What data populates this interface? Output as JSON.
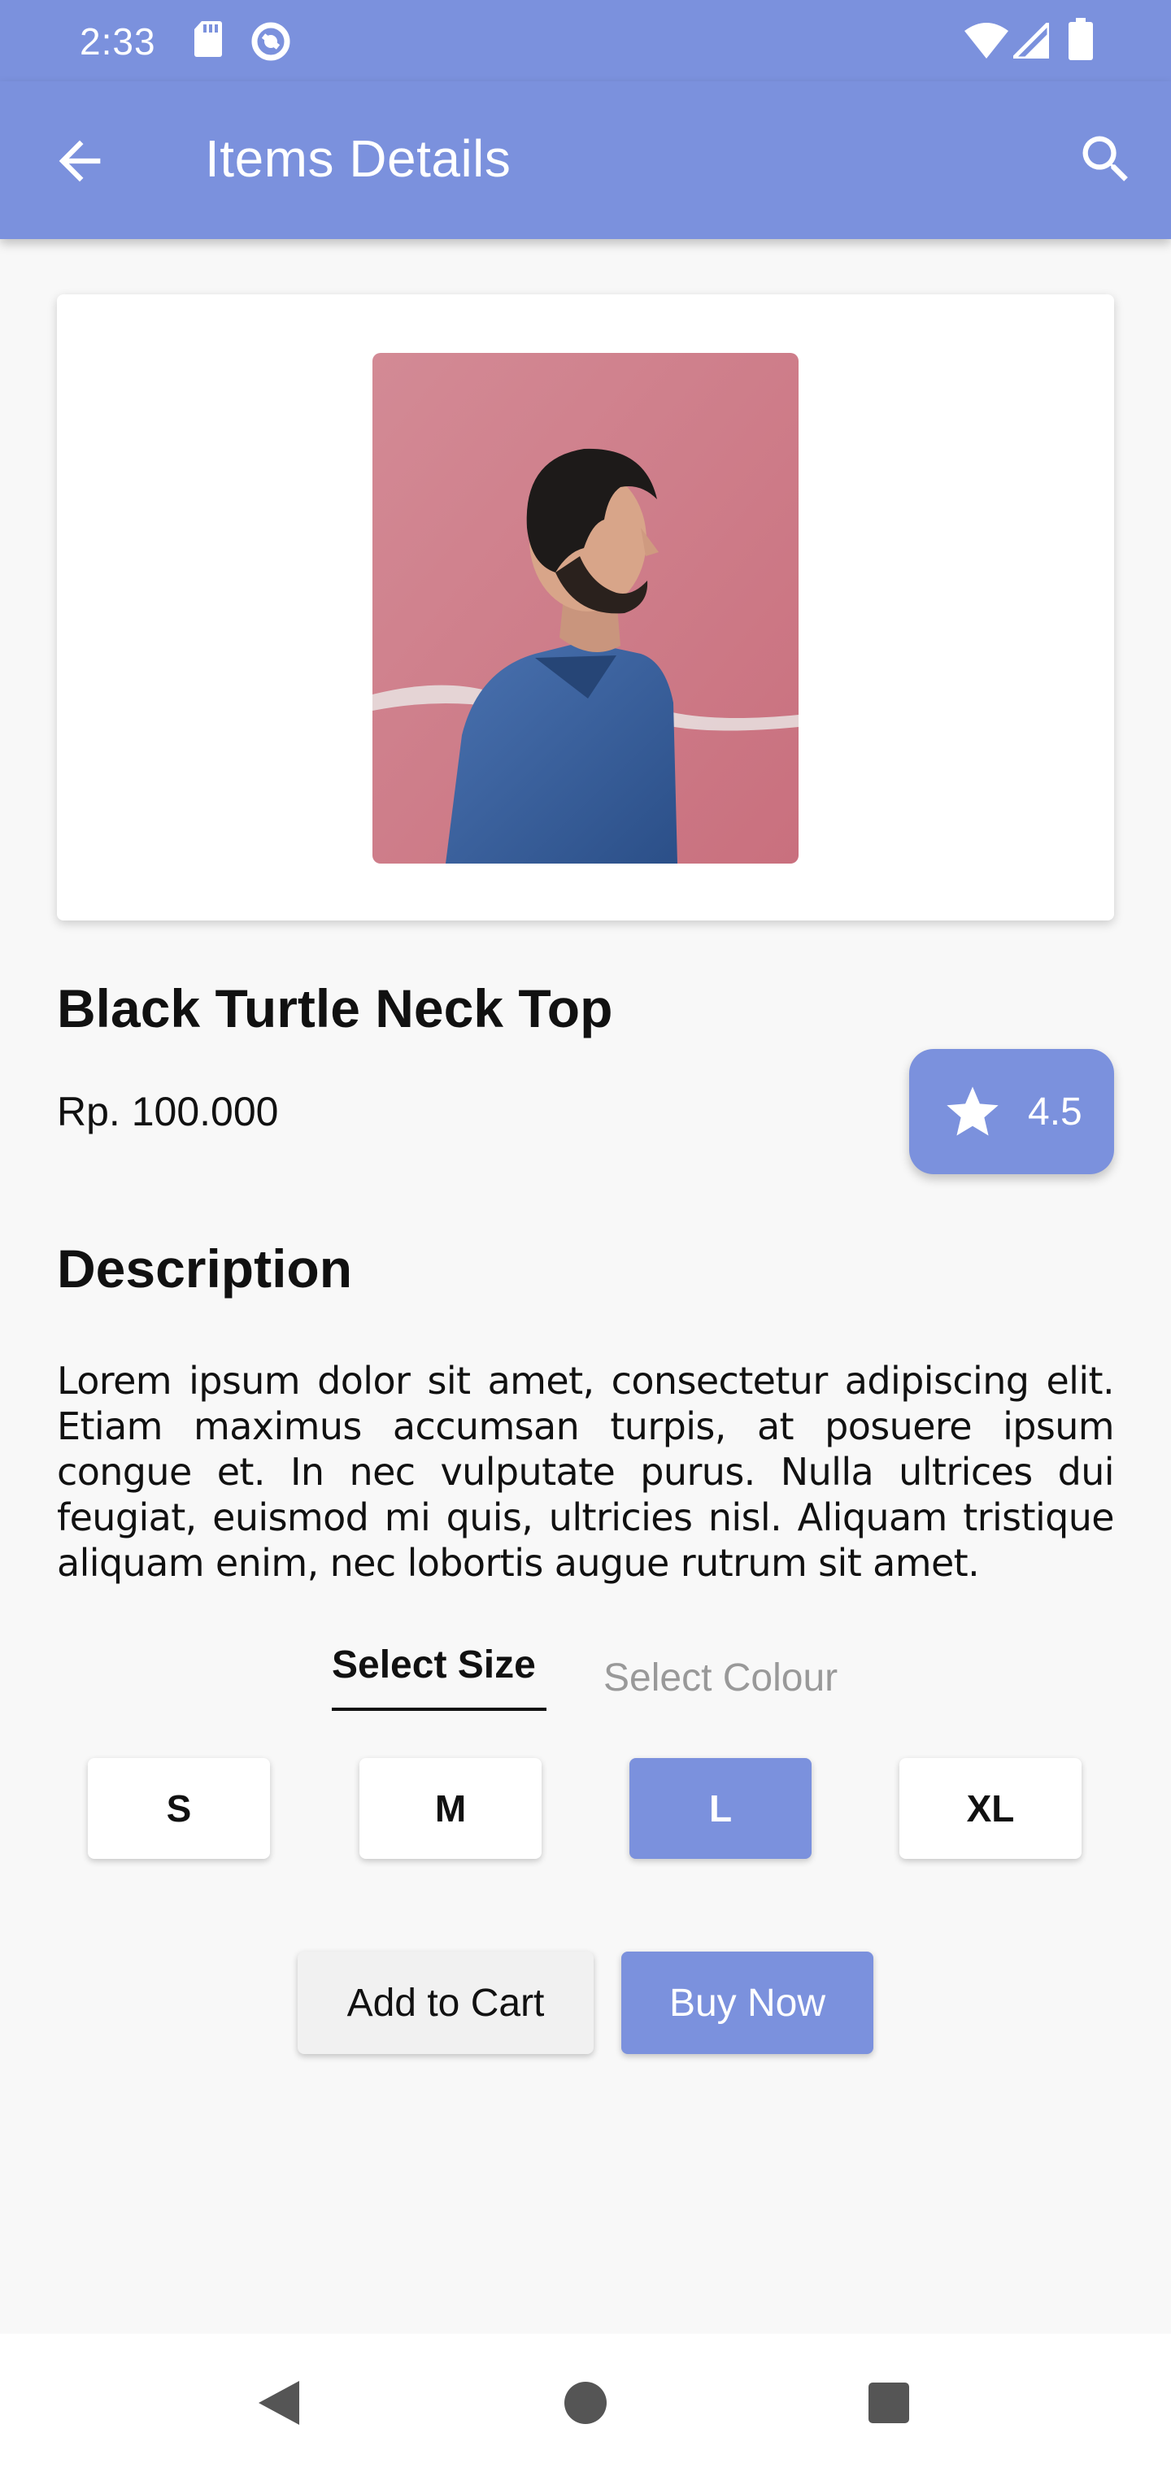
{
  "status_bar": {
    "time": "2:33",
    "left_icons": [
      "sd-card-icon",
      "sync-icon"
    ],
    "right_icons": [
      "wifi-icon",
      "signal-icon",
      "battery-icon"
    ]
  },
  "app_bar": {
    "title": "Items Details",
    "back_icon": "arrow-back-icon",
    "search_icon": "search-icon"
  },
  "product": {
    "name": "Black Turtle Neck Top",
    "price": "Rp. 100.000",
    "rating": "4.5",
    "image_alt": "Man in denim shirt in front of pink wall"
  },
  "description": {
    "heading": "Description",
    "text": "Lorem ipsum dolor sit amet, consectetur adipiscing elit. Etiam maximus accumsan turpis, at posuere ipsum congue et. In nec vulputate purus. Nulla ultrices dui feugiat, euismod mi quis, ultricies nisl. Aliquam tristique aliquam enim, nec lobortis augue rutrum sit amet."
  },
  "tabs": {
    "size": "Select Size",
    "colour": "Select Colour",
    "active": "size"
  },
  "sizes": [
    {
      "label": "S",
      "selected": false
    },
    {
      "label": "M",
      "selected": false
    },
    {
      "label": "L",
      "selected": true
    },
    {
      "label": "XL",
      "selected": false
    }
  ],
  "actions": {
    "add_to_cart": "Add to Cart",
    "buy_now": "Buy Now"
  },
  "colors": {
    "primary": "#7b91dd",
    "background": "#f8f8f8"
  }
}
